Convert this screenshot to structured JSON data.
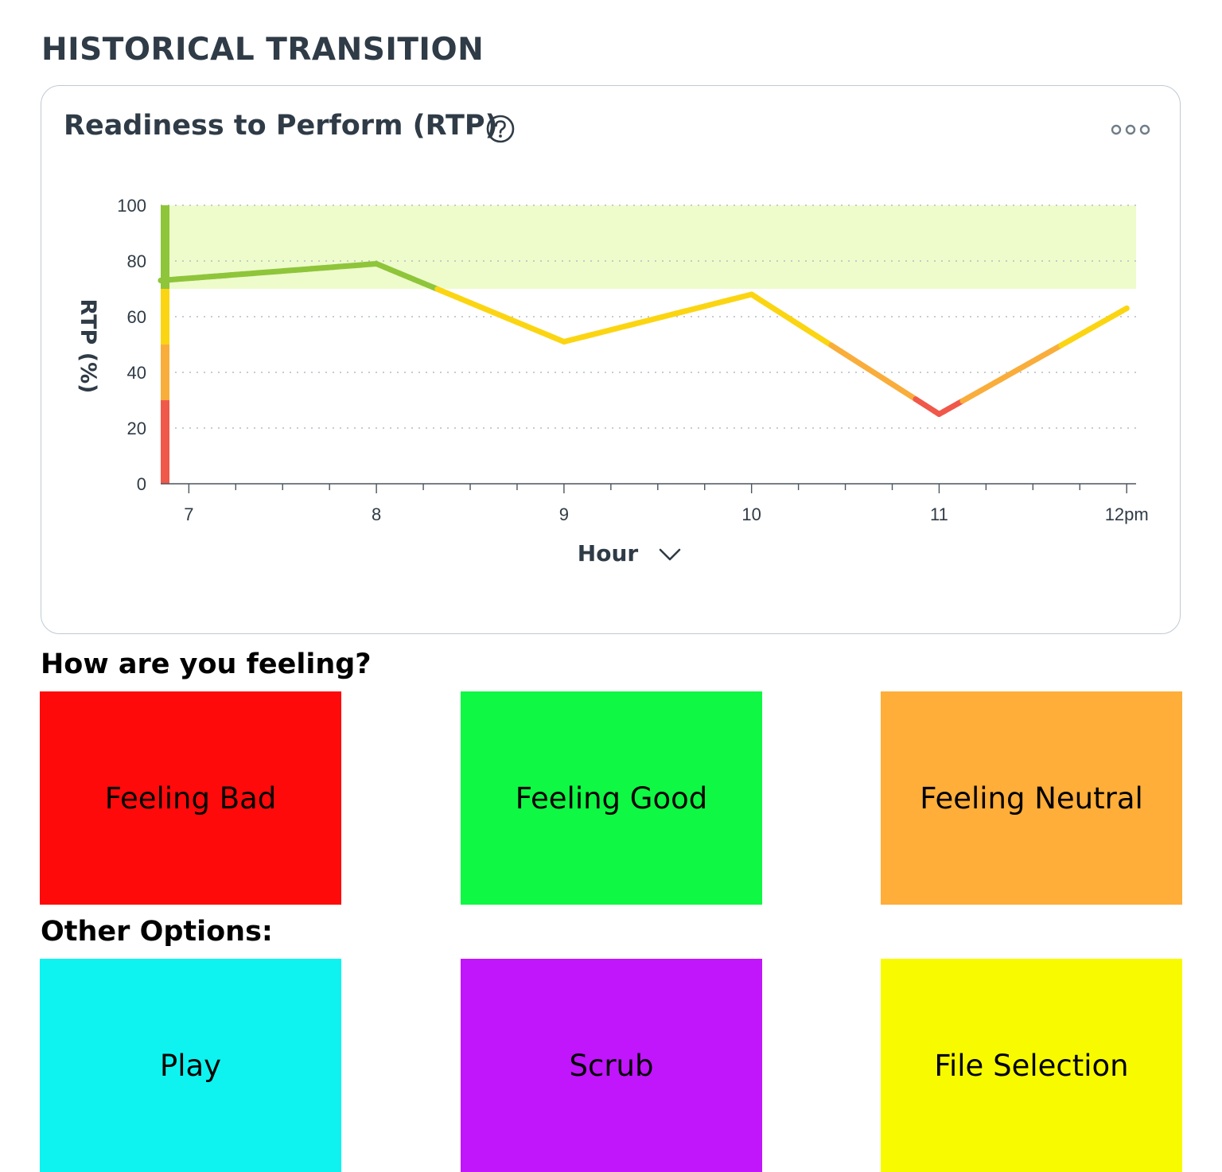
{
  "section_title": "HISTORICAL TRANSITION",
  "card": {
    "title": "Readiness to Perform (RTP)",
    "help_icon": "question-circle-icon",
    "more_icon": "more-options-icon"
  },
  "chart_data": {
    "type": "line",
    "title": "",
    "ylabel": "RTP (%)",
    "xlabel": "Hour",
    "xlabel_icon": "chevron-down-icon",
    "ylim": [
      0,
      100
    ],
    "yticks": [
      0,
      20,
      40,
      60,
      80,
      100
    ],
    "xlim": [
      6.85,
      12.05
    ],
    "xticks": [
      {
        "value": 7,
        "label": "7"
      },
      {
        "value": 8,
        "label": "8"
      },
      {
        "value": 9,
        "label": "9"
      },
      {
        "value": 10,
        "label": "10"
      },
      {
        "value": 11,
        "label": "11"
      },
      {
        "value": 12,
        "label": "12pm"
      }
    ],
    "grid": "horizontal-dotted",
    "target_band": [
      70,
      100
    ],
    "target_band_color": "#eefccc",
    "zones": [
      {
        "from": 0,
        "to": 30,
        "color": "#f0584a"
      },
      {
        "from": 30,
        "to": 50,
        "color": "#f9ad3b"
      },
      {
        "from": 50,
        "to": 70,
        "color": "#fbd512"
      },
      {
        "from": 70,
        "to": 100,
        "color": "#8fc53a"
      }
    ],
    "series": [
      {
        "x": [
          6.85,
          8.0,
          9.0,
          10.0,
          11.0,
          12.0
        ],
        "values": [
          73,
          79,
          51,
          68,
          25,
          63
        ]
      }
    ]
  },
  "feeling": {
    "heading": "How are you feeling?",
    "options": [
      {
        "label": "Feeling Bad",
        "color": "#ff0a0a"
      },
      {
        "label": "Feeling Good",
        "color": "#0ff843"
      },
      {
        "label": "Feeling Neutral",
        "color": "#feae39"
      }
    ]
  },
  "other": {
    "heading": "Other Options:",
    "options": [
      {
        "label": "Play",
        "color": "#0ef3f0"
      },
      {
        "label": "Scrub",
        "color": "#c115fc"
      },
      {
        "label": "File Selection",
        "color": "#f8fb00"
      }
    ]
  }
}
